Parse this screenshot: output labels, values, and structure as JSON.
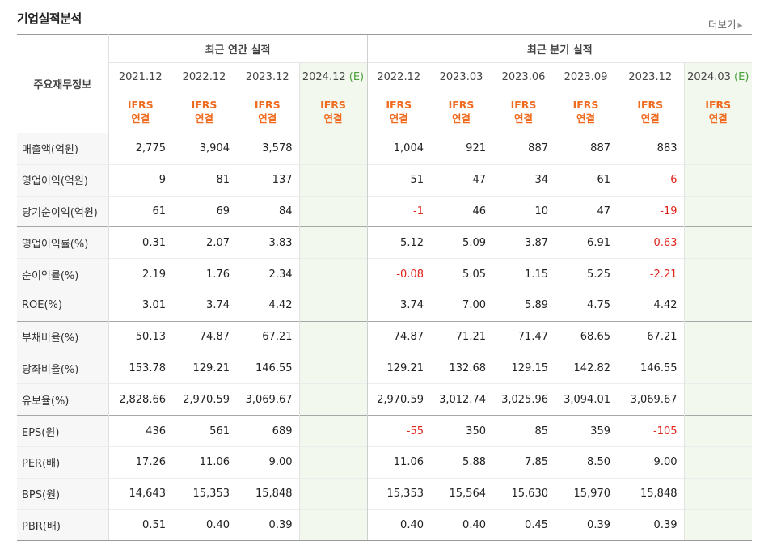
{
  "section_title": "기업실적분석",
  "more_link": "더보기",
  "header": {
    "label": "주요재무정보",
    "annual_group": "최근 연간 실적",
    "quarter_group": "최근 분기 실적",
    "ifrs_line1": "IFRS",
    "ifrs_line2": "연결",
    "annual_years": [
      "2021.12",
      "2022.12",
      "2023.12"
    ],
    "annual_est": {
      "year": "2024.12",
      "mark": "(E)"
    },
    "quarter_periods": [
      "2022.12",
      "2023.03",
      "2023.06",
      "2023.09",
      "2023.12"
    ],
    "quarter_est": {
      "period": "2024.03",
      "mark": "(E)"
    }
  },
  "rows": [
    {
      "label": "매출액(억원)",
      "annual": [
        "2,775",
        "3,904",
        "3,578",
        ""
      ],
      "quarter": [
        "1,004",
        "921",
        "887",
        "887",
        "883",
        ""
      ]
    },
    {
      "label": "영업이익(억원)",
      "annual": [
        "9",
        "81",
        "137",
        ""
      ],
      "quarter": [
        "51",
        "47",
        "34",
        "61",
        "-6",
        ""
      ]
    },
    {
      "label": "당기순이익(억원)",
      "annual": [
        "61",
        "69",
        "84",
        ""
      ],
      "quarter": [
        "-1",
        "46",
        "10",
        "47",
        "-19",
        ""
      ]
    },
    {
      "label": "영업이익률(%)",
      "annual": [
        "0.31",
        "2.07",
        "3.83",
        ""
      ],
      "quarter": [
        "5.12",
        "5.09",
        "3.87",
        "6.91",
        "-0.63",
        ""
      ]
    },
    {
      "label": "순이익률(%)",
      "annual": [
        "2.19",
        "1.76",
        "2.34",
        ""
      ],
      "quarter": [
        "-0.08",
        "5.05",
        "1.15",
        "5.25",
        "-2.21",
        ""
      ]
    },
    {
      "label": "ROE(%)",
      "annual": [
        "3.01",
        "3.74",
        "4.42",
        ""
      ],
      "quarter": [
        "3.74",
        "7.00",
        "5.89",
        "4.75",
        "4.42",
        ""
      ]
    },
    {
      "label": "부채비율(%)",
      "annual": [
        "50.13",
        "74.87",
        "67.21",
        ""
      ],
      "quarter": [
        "74.87",
        "71.21",
        "71.47",
        "68.65",
        "67.21",
        ""
      ]
    },
    {
      "label": "당좌비율(%)",
      "annual": [
        "153.78",
        "129.21",
        "146.55",
        ""
      ],
      "quarter": [
        "129.21",
        "132.68",
        "129.15",
        "142.82",
        "146.55",
        ""
      ]
    },
    {
      "label": "유보율(%)",
      "annual": [
        "2,828.66",
        "2,970.59",
        "3,069.67",
        ""
      ],
      "quarter": [
        "2,970.59",
        "3,012.74",
        "3,025.96",
        "3,094.01",
        "3,069.67",
        ""
      ]
    },
    {
      "label": "EPS(원)",
      "annual": [
        "436",
        "561",
        "689",
        ""
      ],
      "quarter": [
        "-55",
        "350",
        "85",
        "359",
        "-105",
        ""
      ]
    },
    {
      "label": "PER(배)",
      "annual": [
        "17.26",
        "11.06",
        "9.00",
        ""
      ],
      "quarter": [
        "11.06",
        "5.88",
        "7.85",
        "8.50",
        "9.00",
        ""
      ]
    },
    {
      "label": "BPS(원)",
      "annual": [
        "14,643",
        "15,353",
        "15,848",
        ""
      ],
      "quarter": [
        "15,353",
        "15,564",
        "15,630",
        "15,970",
        "15,848",
        ""
      ]
    },
    {
      "label": "PBR(배)",
      "annual": [
        "0.51",
        "0.40",
        "0.39",
        ""
      ],
      "quarter": [
        "0.40",
        "0.40",
        "0.45",
        "0.39",
        "0.39",
        ""
      ]
    }
  ],
  "colors": {
    "negative": "#e2231a",
    "ifrs": "#ef6b1f",
    "estimate_bg": "#f2f8ee",
    "estimate_mark": "#4aa03a"
  }
}
